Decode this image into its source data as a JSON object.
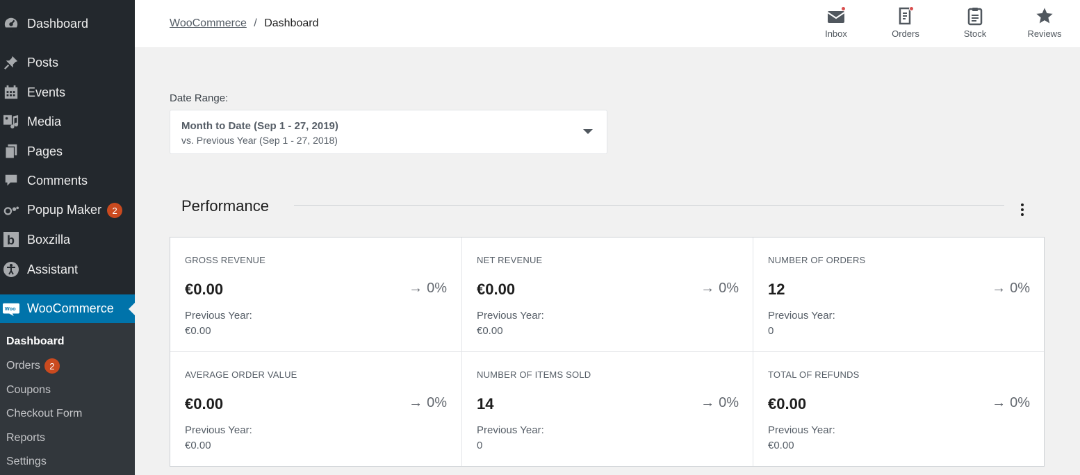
{
  "sidebar": {
    "items": [
      {
        "label": "Dashboard",
        "icon": "dashboard-icon"
      },
      {
        "label": "Posts",
        "icon": "pin-icon"
      },
      {
        "label": "Events",
        "icon": "calendar-icon"
      },
      {
        "label": "Media",
        "icon": "media-icon"
      },
      {
        "label": "Pages",
        "icon": "pages-icon"
      },
      {
        "label": "Comments",
        "icon": "comment-icon"
      },
      {
        "label": "Popup Maker",
        "icon": "popup-maker-icon",
        "badge": "2"
      },
      {
        "label": "Boxzilla",
        "icon": "boxzilla-icon"
      },
      {
        "label": "Assistant",
        "icon": "accessibility-icon"
      },
      {
        "label": "WooCommerce",
        "icon": "woo-icon"
      }
    ],
    "submenu": [
      {
        "label": "Dashboard"
      },
      {
        "label": "Orders",
        "badge": "2"
      },
      {
        "label": "Coupons"
      },
      {
        "label": "Checkout Form"
      },
      {
        "label": "Reports"
      },
      {
        "label": "Settings"
      }
    ]
  },
  "header": {
    "breadcrumb_link": "WooCommerce",
    "breadcrumb_sep": "/",
    "breadcrumb_current": "Dashboard",
    "actions": [
      {
        "label": "Inbox",
        "icon": "inbox-icon"
      },
      {
        "label": "Orders",
        "icon": "orders-icon"
      },
      {
        "label": "Stock",
        "icon": "clipboard-icon"
      },
      {
        "label": "Reviews",
        "icon": "star-icon"
      }
    ]
  },
  "date_range": {
    "label": "Date Range:",
    "primary": "Month to Date (Sep 1 - 27, 2019)",
    "secondary": "vs. Previous Year (Sep 1 - 27, 2018)"
  },
  "performance": {
    "title": "Performance",
    "cards": [
      {
        "label": "GROSS REVENUE",
        "value": "€0.00",
        "delta": "0%",
        "prev_label": "Previous Year:",
        "prev_value": "€0.00"
      },
      {
        "label": "NET REVENUE",
        "value": "€0.00",
        "delta": "0%",
        "prev_label": "Previous Year:",
        "prev_value": "€0.00"
      },
      {
        "label": "NUMBER OF ORDERS",
        "value": "12",
        "delta": "0%",
        "prev_label": "Previous Year:",
        "prev_value": "0"
      },
      {
        "label": "AVERAGE ORDER VALUE",
        "value": "€0.00",
        "delta": "0%",
        "prev_label": "Previous Year:",
        "prev_value": "€0.00"
      },
      {
        "label": "NUMBER OF ITEMS SOLD",
        "value": "14",
        "delta": "0%",
        "prev_label": "Previous Year:",
        "prev_value": "0"
      },
      {
        "label": "TOTAL OF REFUNDS",
        "value": "€0.00",
        "delta": "0%",
        "prev_label": "Previous Year:",
        "prev_value": "€0.00"
      }
    ]
  },
  "colors": {
    "sidebar_bg": "#23282d",
    "submenu_bg": "#32373c",
    "active_bg": "#0073aa",
    "badge": "#ca4a1f",
    "notification_dot": "#d94f4f"
  }
}
